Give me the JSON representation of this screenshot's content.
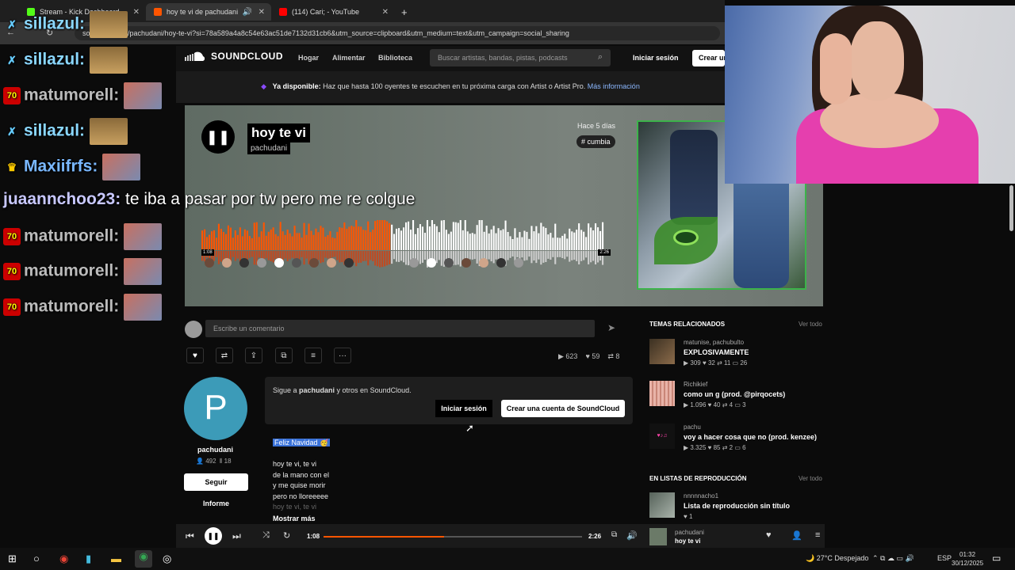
{
  "browser": {
    "tabs": [
      {
        "title": "Stream - Kick Dashboard",
        "color": "#53fc18"
      },
      {
        "title": "hoy te vi de pachudani",
        "color": "#ff5500"
      },
      {
        "title": "(114) Cari; - YouTube",
        "color": "#ff0000"
      }
    ],
    "url": "soundcl…com/pachudani/hoy-te-vi?si=78a589a4a8c54e63ac51de7132d31cb6&utm_source=clipboard&utm_medium=text&utm_campaign=social_sharing"
  },
  "soundcloud": {
    "logo": "SOUNDCLOUD",
    "nav": [
      "Hogar",
      "Alimentar",
      "Biblioteca"
    ],
    "search_placeholder": "Buscar artistas, bandas, pistas, podcasts",
    "signin": "Iniciar sesión",
    "create": "Crear una cuenta",
    "banner": {
      "strong": "Ya disponible:",
      "text": " Haz que hasta 100 oyentes te escuchen en tu próxima carga con Artist o Artist Pro. ",
      "link": "Más información"
    },
    "track": {
      "title": "hoy te vi",
      "artist": "pachudani",
      "posted": "Hace 5 días",
      "tag": "# cumbia",
      "elapsed": "1:08",
      "duration": "2:26",
      "progress": 0.466
    },
    "comment_placeholder": "Escribe un comentario",
    "stats": {
      "plays": "623",
      "likes": "59",
      "reposts": "8"
    },
    "profile": {
      "initial": "P",
      "name": "pachudani",
      "followers": "492",
      "tracks": "18",
      "follow": "Seguir",
      "report": "Informe"
    },
    "popup": {
      "text_pre": "Sigue a ",
      "text_name": "pachudani",
      "text_post": " y otros en SoundCloud.",
      "signin": "Iniciar sesión",
      "create": "Crear una cuenta de SoundCloud"
    },
    "description": {
      "highlight": "Feliz Navidad 🥳",
      "lines": [
        "hoy te vi, te vi",
        "de la mano con el",
        "y me quise morir",
        "pero no lloreeeee",
        "hoy te vi, te vi"
      ],
      "more": "Mostrar más"
    },
    "related": {
      "heading": "TEMAS RELACIONADOS",
      "see_all": "Ver todo",
      "items": [
        {
          "artist": "matunise, pachubulto",
          "title": "EXPLOSIVAMENTE",
          "plays": "309",
          "likes": "32",
          "reposts": "11",
          "comments": "26"
        },
        {
          "artist": "Richikief",
          "title": "como un g (prod. @pirqocets)",
          "plays": "1.096",
          "likes": "40",
          "reposts": "4",
          "comments": "3"
        },
        {
          "artist": "pachu",
          "title": "voy a hacer cosa que no (prod. kenzee)",
          "plays": "3.325",
          "likes": "85",
          "reposts": "2",
          "comments": "6"
        }
      ]
    },
    "playlists": {
      "heading": "EN LISTAS DE REPRODUCCIÓN",
      "see_all": "Ver todo",
      "items": [
        {
          "artist": "nnnnnacho1",
          "title": "Lista de reproducción sin título",
          "likes": "1"
        }
      ]
    },
    "player": {
      "elapsed": "1:08",
      "duration": "2:26",
      "artist": "pachudani",
      "title": "hoy te vi"
    }
  },
  "chat": [
    {
      "user": "sillazul:",
      "msg": ""
    },
    {
      "user": "matumorell:",
      "msg": ""
    },
    {
      "user": "sillazul:",
      "msg": ""
    },
    {
      "user": "Maxiifrfs:",
      "msg": ""
    },
    {
      "user": "juaannchoo23:",
      "msg": " te iba a pasar por tw pero me re colgue"
    },
    {
      "user": "matumorell:",
      "msg": ""
    },
    {
      "user": "matumorell:",
      "msg": ""
    },
    {
      "user": "matumorell:",
      "msg": ""
    }
  ],
  "taskbar": {
    "weather": "27°C  Despejado",
    "lang": "ESP",
    "time": "01:32",
    "date": "30/12/2025"
  },
  "colors": {
    "accent": "#ff5500",
    "kick": "#53fc18"
  }
}
